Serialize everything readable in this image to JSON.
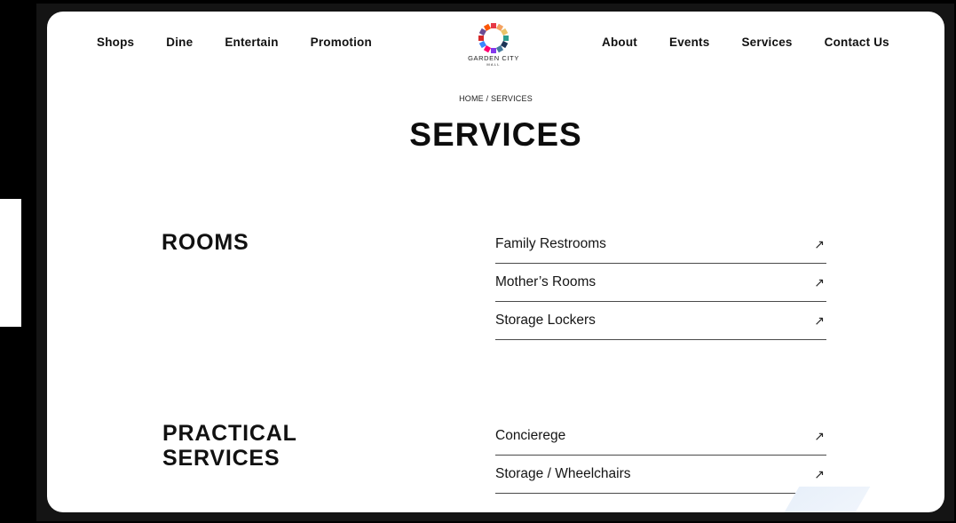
{
  "nav": {
    "left": [
      "Shops",
      "Dine",
      "Entertain",
      "Promotion"
    ],
    "right": [
      "About",
      "Events",
      "Services",
      "Contact Us"
    ]
  },
  "logo": {
    "name": "GARDEN CITY",
    "sub": "MALL"
  },
  "breadcrumb": "HOME / SERVICES",
  "page_title": "SERVICES",
  "sections": [
    {
      "title_lines": [
        "ROOMS"
      ],
      "items": [
        "Family Restrooms",
        "Mother’s Rooms",
        "Storage Lockers"
      ]
    },
    {
      "title_lines": [
        "PRACTICAL",
        "SERVICES"
      ],
      "items": [
        "Concierege",
        "Storage / Wheelchairs"
      ]
    }
  ],
  "arrow_glyph": "↗",
  "icons": {
    "item_arrow": "arrow-up-right-icon",
    "logo": "garden-city-flower-logo"
  }
}
